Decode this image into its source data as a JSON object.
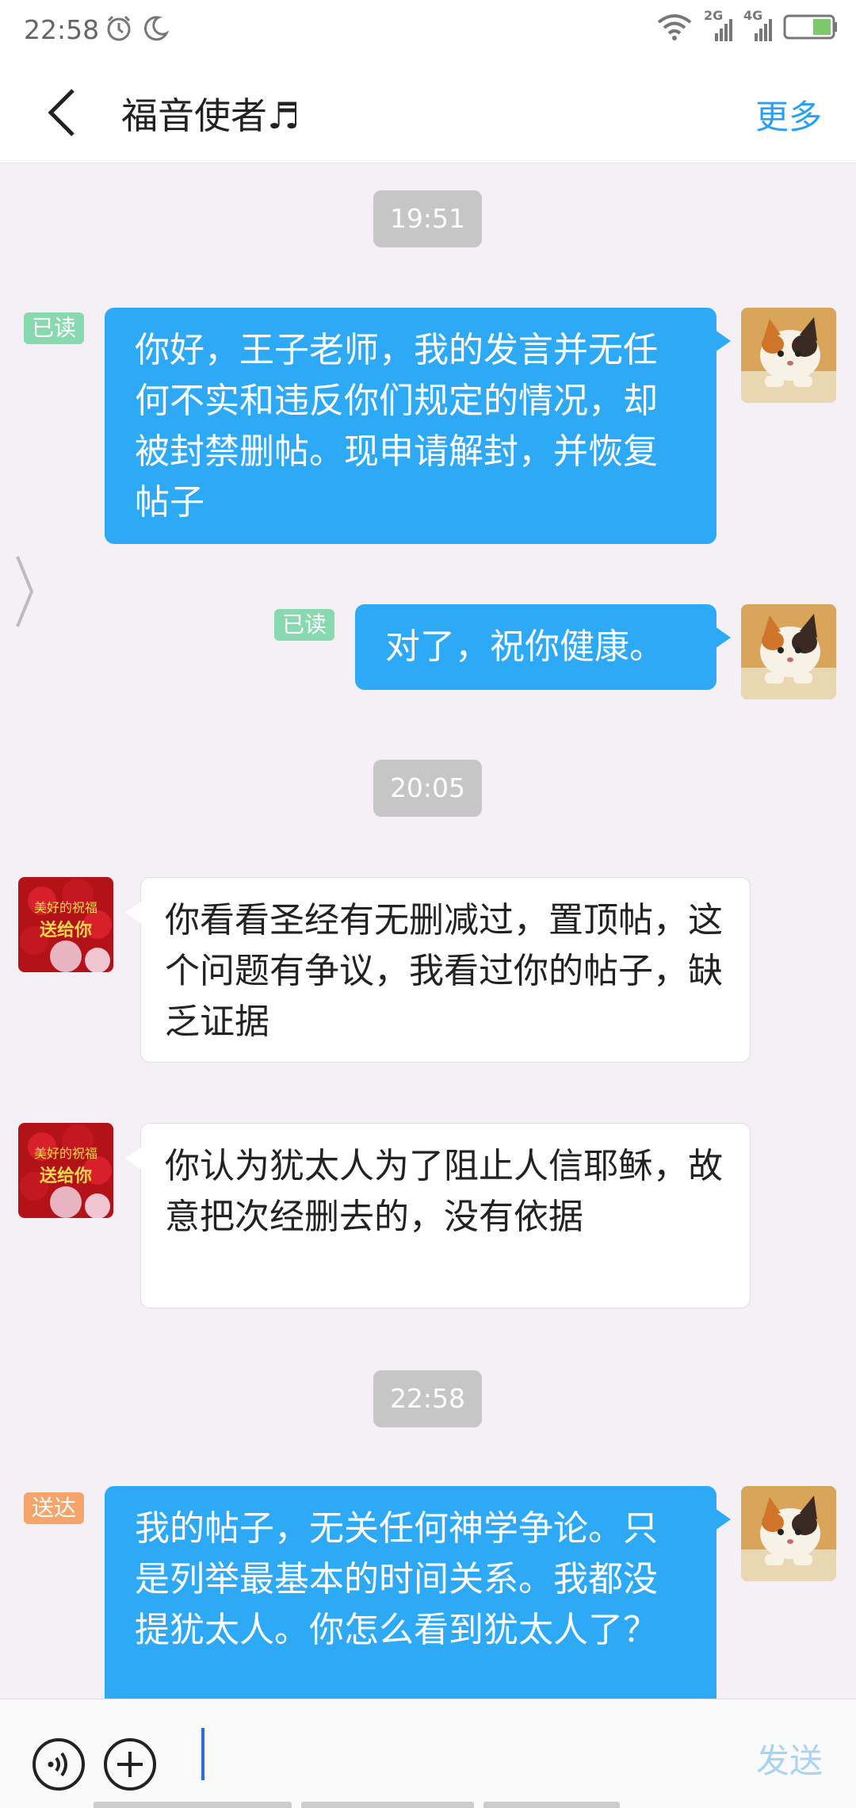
{
  "status_bar": {
    "time": "22:58",
    "net_label_1": "2G",
    "net_label_2": "4G"
  },
  "header": {
    "title": "福音使者♬",
    "more_label": "更多"
  },
  "messages": [
    {
      "type": "time",
      "text": "19:51"
    },
    {
      "type": "outgoing",
      "status": "已读",
      "text": "你好，王子老师，我的发言并无任何不实和违反你们规定的情况，却被封禁删帖。现申请解封，并恢复帖子"
    },
    {
      "type": "outgoing",
      "status": "已读",
      "text": "对了，祝你健康。"
    },
    {
      "type": "time",
      "text": "20:05"
    },
    {
      "type": "incoming",
      "text": "你看看圣经有无删减过，置顶帖，这个问题有争议，我看过你的帖子，缺乏证据"
    },
    {
      "type": "incoming",
      "text": "你认为犹太人为了阻止人信耶稣，故意把次经删去的，没有依据"
    },
    {
      "type": "time",
      "text": "22:58"
    },
    {
      "type": "outgoing",
      "status": "送达",
      "text": "我的帖子，无关任何神学争论。只是列举最基本的时间关系。我都没提犹太人。你怎么看到犹太人了？"
    }
  ],
  "avatar_rose_text": [
    "美好的祝福",
    "送给你"
  ],
  "input_bar": {
    "send_label": "发送",
    "placeholder": ""
  },
  "colors": {
    "outgoing_bubble": "#2ea9f6",
    "read_badge": "#88d9b0",
    "sent_badge": "#f7a46a",
    "accent": "#2aa0f0"
  },
  "icons": {
    "back": "chevron-left-icon",
    "voice": "voice-icon",
    "plus": "plus-icon",
    "alarm": "alarm-icon",
    "moon": "moon-icon",
    "wifi": "wifi-icon",
    "battery": "battery-icon"
  }
}
